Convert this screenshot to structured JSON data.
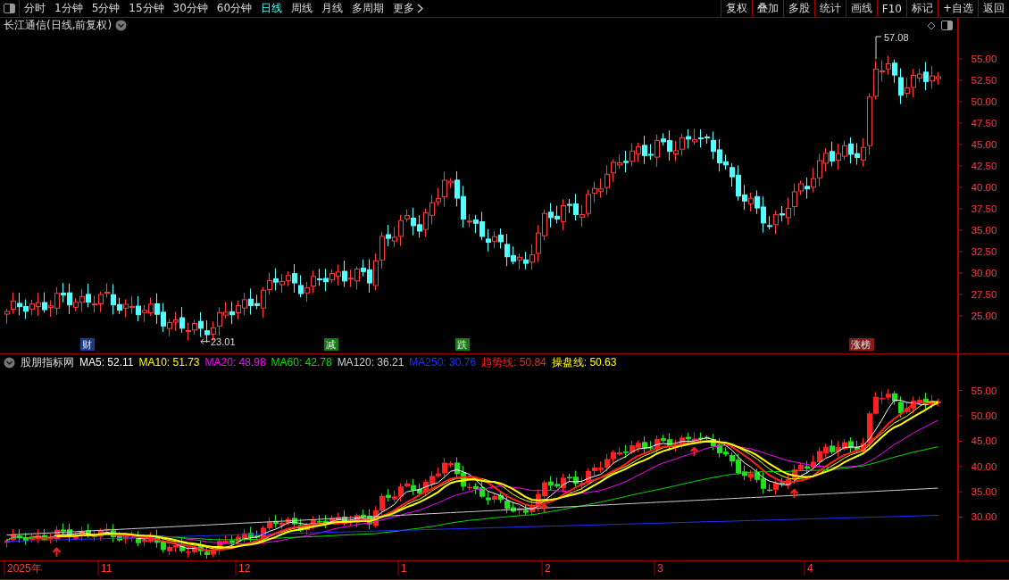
{
  "toolbar": {
    "periods": [
      {
        "label": "分时",
        "selected": false
      },
      {
        "label": "1分钟",
        "selected": false
      },
      {
        "label": "5分钟",
        "selected": false
      },
      {
        "label": "15分钟",
        "selected": false
      },
      {
        "label": "30分钟",
        "selected": false
      },
      {
        "label": "60分钟",
        "selected": false
      },
      {
        "label": "日线",
        "selected": true
      },
      {
        "label": "周线",
        "selected": false
      },
      {
        "label": "月线",
        "selected": false
      },
      {
        "label": "多周期",
        "selected": false
      }
    ],
    "more": "更多",
    "actions": [
      "复权",
      "叠加",
      "多股",
      "统计",
      "画线",
      "F10",
      "标记",
      "+自选",
      "返回"
    ]
  },
  "main_chart": {
    "title": "长江通信(日线,前复权)",
    "high_label": "57.08",
    "low_label": "23.01",
    "y_ticks": [
      "55.00",
      "52.50",
      "50.00",
      "47.50",
      "45.00",
      "42.50",
      "40.00",
      "37.50",
      "35.00",
      "32.50",
      "30.00",
      "27.50",
      "25.00"
    ],
    "markers": [
      {
        "text": "财",
        "color": "#1c3c8c"
      },
      {
        "text": "减",
        "color": "#1a7a1a"
      },
      {
        "text": "跌",
        "color": "#1a7a1a"
      },
      {
        "text": "涨榜",
        "color": "#8a1a1a"
      }
    ]
  },
  "indicator": {
    "name": "股朋指标网",
    "legend": [
      {
        "text": "MA5: 52.11",
        "color": "#ffffff"
      },
      {
        "text": "MA10: 51.73",
        "color": "#ffff00"
      },
      {
        "text": "MA20: 48.98",
        "color": "#ff00ff"
      },
      {
        "text": "MA60: 42.78",
        "color": "#00e000"
      },
      {
        "text": "MA120: 36.21",
        "color": "#d0d0d0"
      },
      {
        "text": "MA250: 30.76",
        "color": "#1e32ff"
      },
      {
        "text": "趋势线: 50.84",
        "color": "#ff2020"
      },
      {
        "text": "操盘线: 50.63",
        "color": "#ffff00"
      }
    ],
    "y_ticks": [
      "55.00",
      "50.00",
      "45.00",
      "40.00",
      "35.00",
      "30.00"
    ]
  },
  "date_axis": [
    "2025年",
    "11",
    "12",
    "1",
    "2",
    "3",
    "4"
  ]
}
